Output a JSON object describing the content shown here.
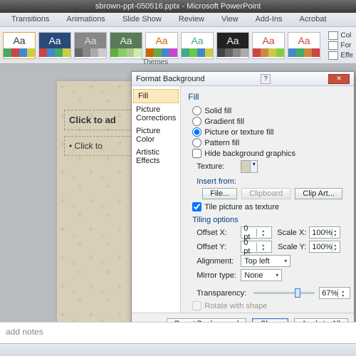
{
  "window": {
    "title": "sbrown-ppt-050516.pptx - Microsoft PowerPoint"
  },
  "ribbon": {
    "tabs": [
      "Transitions",
      "Animations",
      "Slide Show",
      "Review",
      "View",
      "Add-Ins",
      "Acrobat"
    ],
    "group_label": "Themes",
    "controls": {
      "colors": "Col",
      "fonts": "For",
      "effects": "Effe"
    }
  },
  "slide": {
    "title_ph": "Click to ad",
    "body_ph": "Click to"
  },
  "dialog": {
    "title": "Format Background",
    "nav": [
      "Fill",
      "Picture Corrections",
      "Picture Color",
      "Artistic Effects"
    ],
    "header": "Fill",
    "fill": {
      "solid": "Solid fill",
      "gradient": "Gradient fill",
      "picture": "Picture or texture fill",
      "pattern": "Pattern fill",
      "hide": "Hide background graphics"
    },
    "texture_label": "Texture:",
    "insert_label": "Insert from:",
    "buttons": {
      "file": "File...",
      "clipboard": "Clipboard",
      "clipart": "Clip Art..."
    },
    "tile_check": "Tile picture as texture",
    "tiling_header": "Tiling options",
    "tiling": {
      "offsetx": {
        "label": "Offset X:",
        "value": "0 pt"
      },
      "offsety": {
        "label": "Offset Y:",
        "value": "0 pt"
      },
      "scalex": {
        "label": "Scale X:",
        "value": "100%"
      },
      "scaley": {
        "label": "Scale Y:",
        "value": "100%"
      },
      "align": {
        "label": "Alignment:",
        "value": "Top left"
      },
      "mirror": {
        "label": "Mirror type:",
        "value": "None"
      }
    },
    "transparency": {
      "label": "Transparency:",
      "value": "67%"
    },
    "rotate": "Rotate with shape",
    "footer": {
      "reset": "Reset Background",
      "close": "Close",
      "apply": "Apply to All"
    }
  },
  "notes": {
    "placeholder": "add notes"
  }
}
